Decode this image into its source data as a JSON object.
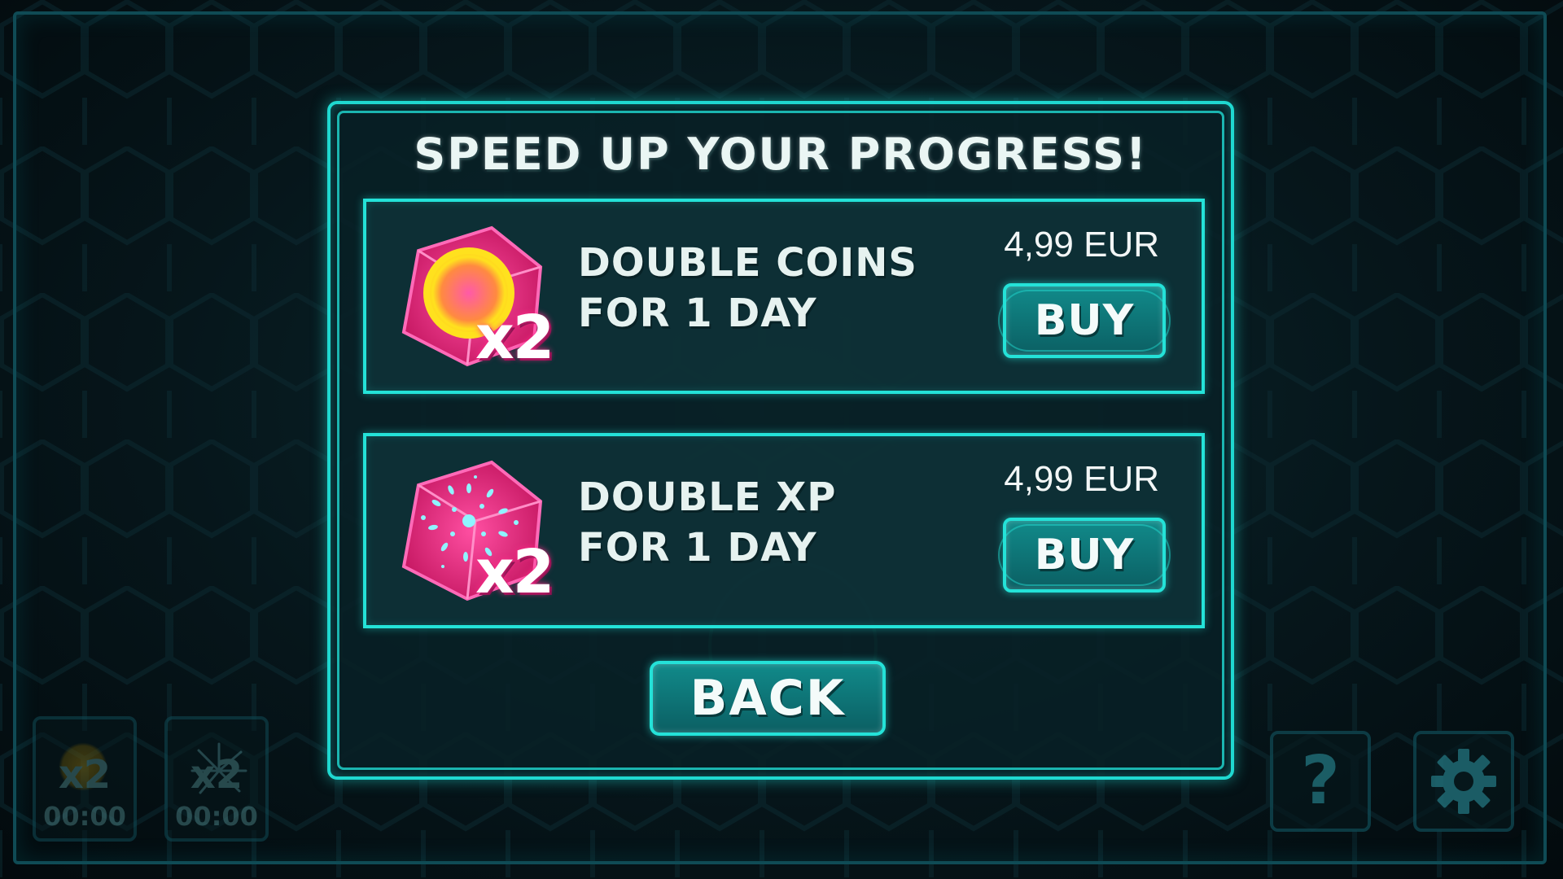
{
  "dialog": {
    "title": "SPEED UP YOUR PROGRESS!",
    "offers": [
      {
        "name": "DOUBLE COINS",
        "duration": "FOR 1 DAY",
        "price": "4,99 EUR",
        "button_label": "BUY",
        "multiplier": "x2",
        "icon": "coin-cube-icon"
      },
      {
        "name": "DOUBLE XP",
        "duration": "FOR 1 DAY",
        "price": "4,99 EUR",
        "button_label": "BUY",
        "multiplier": "x2",
        "icon": "xp-cube-icon"
      }
    ],
    "back_label": "BACK"
  },
  "boosts": [
    {
      "multiplier": "x2",
      "timer": "00:00",
      "icon": "coin-boost-icon"
    },
    {
      "multiplier": "x2",
      "timer": "00:00",
      "icon": "xp-boost-icon"
    }
  ],
  "corner_buttons": {
    "help_glyph": "?",
    "help_icon": "question-mark-icon",
    "settings_icon": "gear-icon"
  },
  "colors": {
    "accent": "#24e2d8",
    "panel": "#0e3238",
    "cube_pink": "#ff2a8a",
    "coin_yellow": "#ffd21e",
    "text": "#eaf6f4"
  }
}
